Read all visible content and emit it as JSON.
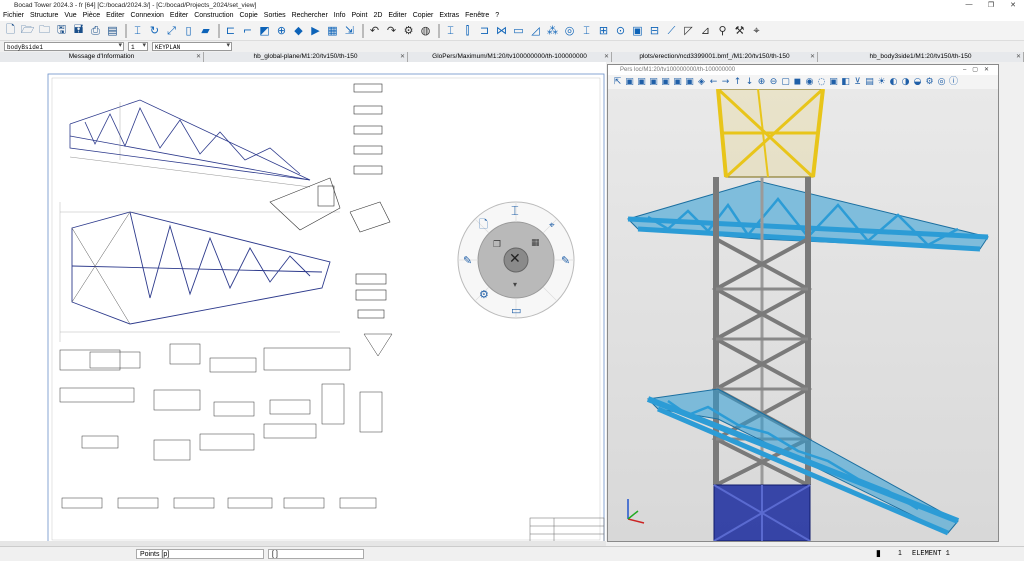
{
  "app": {
    "title": "Bocad Tower 2024.3 - fr [64] [C:/bocad/2024.3/] - [C:/bocad/Projects_2024/set_view]",
    "window_controls": [
      "—",
      "❐",
      "✕"
    ]
  },
  "menu": [
    "Fichier",
    "Structure",
    "Vue",
    "Pièce",
    "Editer",
    "Connexion",
    "Editer",
    "Construction",
    "Copie",
    "Sorties",
    "Rechercher",
    "Info",
    "Point",
    "2D",
    "Editer",
    "Copier",
    "Extras",
    "Fenêtre",
    "?"
  ],
  "selectors": {
    "view_name": "bodyBside1",
    "layer": "1",
    "plan": "KEYPLAN"
  },
  "tabs": [
    {
      "label": "Message d'Information"
    },
    {
      "label": "hb_global-plane/M1:20/tv150/th-150"
    },
    {
      "label": "GloPers/Maximum/M1:20/tv100000000/th-100000000"
    },
    {
      "label": "plots/erection/ncd3399001.bmf_/M1:20/tv150/th-150"
    },
    {
      "label": "hb_body3side1/M1:20/tv150/th-150"
    }
  ],
  "viewer": {
    "title": "Pers loc/M1:20/tv100000000/th-100000000"
  },
  "status": {
    "mode": "Points [p]",
    "input": "[ ]",
    "level": "1",
    "element": "ELEMENT 1"
  },
  "colors": {
    "tower_yellow": "#e8c51a",
    "crossarm_blue": "#2c9cd6",
    "leg_navy": "#1a2a9e",
    "body_grey": "#7a7a7a"
  }
}
